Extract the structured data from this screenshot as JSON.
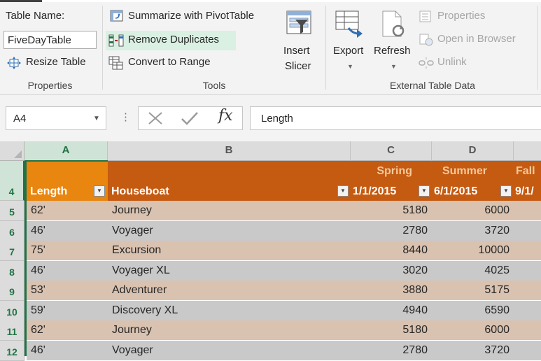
{
  "ribbon": {
    "properties": {
      "table_name_label": "Table Name:",
      "table_name_value": "FiveDayTable",
      "resize_table": "Resize Table",
      "group_label": "Properties"
    },
    "tools": {
      "summarize": "Summarize with PivotTable",
      "remove_duplicates": "Remove Duplicates",
      "convert_range": "Convert to Range",
      "insert_slicer_1": "Insert",
      "insert_slicer_2": "Slicer",
      "group_label": "Tools"
    },
    "external": {
      "export": "Export",
      "refresh": "Refresh",
      "properties": "Properties",
      "open_browser": "Open in Browser",
      "unlink": "Unlink",
      "group_label": "External Table Data"
    }
  },
  "formula_bar": {
    "name_box": "A4",
    "fx": "fx",
    "content": "Length"
  },
  "grid": {
    "columns": [
      "A",
      "B",
      "C",
      "D"
    ],
    "header_row_number": "4",
    "headers": {
      "a": "Length",
      "b": "Houseboat",
      "c_top": "Spring",
      "c_bottom": "1/1/2015",
      "d_top": "Summer",
      "d_bottom": "6/1/2015",
      "e_top": "Fall",
      "e_bottom": "9/1/"
    },
    "rows": [
      {
        "num": "5",
        "a": "62'",
        "b": "Journey",
        "c": "5180",
        "d": "6000"
      },
      {
        "num": "6",
        "a": "46'",
        "b": "Voyager",
        "c": "2780",
        "d": "3720"
      },
      {
        "num": "7",
        "a": "75'",
        "b": "Excursion",
        "c": "8440",
        "d": "10000"
      },
      {
        "num": "8",
        "a": "46'",
        "b": "Voyager XL",
        "c": "3020",
        "d": "4025"
      },
      {
        "num": "9",
        "a": "53'",
        "b": "Adventurer",
        "c": "3880",
        "d": "5175"
      },
      {
        "num": "10",
        "a": "59'",
        "b": "Discovery XL",
        "c": "4940",
        "d": "6590"
      },
      {
        "num": "11",
        "a": "62'",
        "b": "Journey",
        "c": "5180",
        "d": "6000"
      },
      {
        "num": "12",
        "a": "46'",
        "b": "Voyager",
        "c": "2780",
        "d": "3720"
      }
    ]
  },
  "colors": {
    "header_bg": "#c55a11",
    "header_selected_bg": "#e8860f",
    "row_odd": "#d9c2b0",
    "row_even": "#c9c9c9",
    "excel_green": "#217346"
  }
}
